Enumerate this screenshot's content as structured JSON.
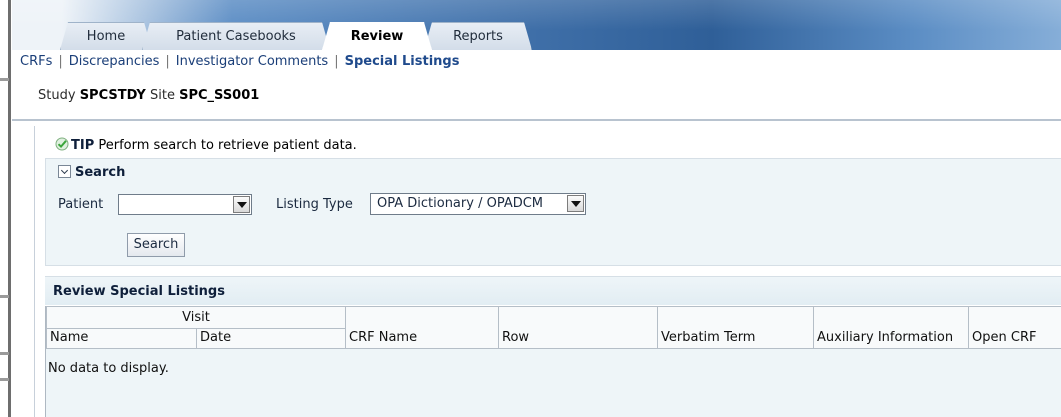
{
  "tabs": [
    {
      "label": "Home"
    },
    {
      "label": "Patient Casebooks"
    },
    {
      "label": "Review"
    },
    {
      "label": "Reports"
    }
  ],
  "subnav": {
    "items": [
      "CRFs",
      "Discrepancies",
      "Investigator Comments",
      "Special Listings"
    ],
    "separator": "|"
  },
  "study": {
    "study_label": "Study",
    "study_value": "SPCSTDY",
    "site_label": "Site",
    "site_value": "SPC_SS001"
  },
  "tip": {
    "label": "TIP",
    "text": "Perform search to retrieve patient data."
  },
  "search": {
    "title": "Search",
    "patient_label": "Patient",
    "patient_value": "",
    "listing_label": "Listing Type",
    "listing_value": "OPA Dictionary / OPADCM",
    "button_label": "Search"
  },
  "results": {
    "title": "Review Special Listings",
    "group_header": "Visit",
    "columns": [
      "Name",
      "Date",
      "CRF Name",
      "Row",
      "Verbatim Term",
      "Auxiliary Information",
      "Open CRF"
    ],
    "empty_text": "No data to display."
  },
  "colors": {
    "header_blue": "#3f6fa8",
    "link_blue": "#1a3e78",
    "panel_bg": "#eef5f8",
    "tip_check": "#3aa53a"
  }
}
